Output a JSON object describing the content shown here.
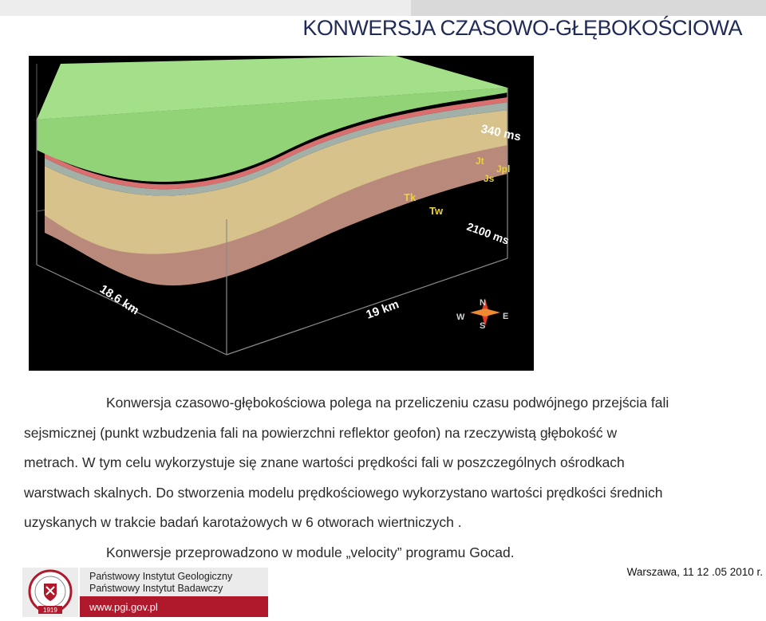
{
  "slide": {
    "title": "KONWERSJA CZASOWO-GŁĘBOKOŚCIOWA"
  },
  "figure": {
    "label_top_time": "340 ms",
    "label_bottom_time": "2100 ms",
    "label_Jt": "Jt",
    "label_Jpl": "Jpl",
    "label_Js": "Js",
    "label_Tk": "Tk",
    "label_Tw": "Tw",
    "label_dim_left": "18.6 km",
    "label_dim_front": "19 km",
    "compass": {
      "n": "N",
      "s": "S",
      "e": "E",
      "w": "W"
    },
    "layer_colors": {
      "top": "#a9e48a",
      "green_body": "#8ecf72",
      "thin_red": "#d86a6a",
      "thin_grey": "#9aa6a0",
      "tan": "#d8c28a",
      "bottom": "#b88a7a"
    }
  },
  "body": {
    "paragraph_1_line_1": "Konwersja czasowo-głębokościowa polega na przeliczeniu czasu podwójnego przejścia fali",
    "paragraph_1_line_2": "sejsmicznej (punkt wzbudzenia fali na powierzchni  reflektor  geofon) na rzeczywistą głębokość w",
    "paragraph_1_line_3": "metrach. W tym celu wykorzystuje się znane wartości prędkości fali w poszczególnych ośrodkach ",
    "paragraph_1_line_4": "warstwach skalnych. Do stworzenia modelu prędkościowego wykorzystano wartości prędkości średnich",
    "paragraph_1_line_5": "uzyskanych w trakcie badań karotażowych w 6 otworach wiertniczych .",
    "paragraph_2": "Konwersje przeprowadzono w module „velocity” programu Gocad."
  },
  "footer": {
    "org_line_1": "Państwowy Instytut Geologiczny",
    "org_line_2": "Państwowy Instytut Badawczy",
    "url": "www.pgi.gov.pl",
    "date": "Warszawa, 11  12 .05  2010 r.",
    "logo_year": "1919"
  }
}
